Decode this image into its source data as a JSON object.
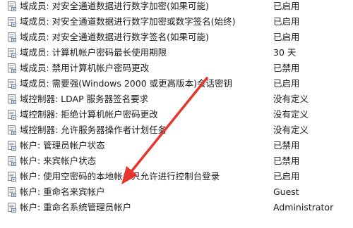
{
  "policies": [
    {
      "name": "域成员: 对安全通道数据进行数字加密(如果可能)",
      "setting": "已启用",
      "icon": "policy-icon"
    },
    {
      "name": "域成员: 对安全通道数据进行数字加密或数字签名(始终)",
      "setting": "已启用",
      "icon": "policy-icon"
    },
    {
      "name": "域成员: 对安全通道数据进行数字签名(如果可能)",
      "setting": "已启用",
      "icon": "policy-icon"
    },
    {
      "name": "域成员: 计算机帐户密码最长使用期限",
      "setting": "30 天",
      "icon": "policy-icon"
    },
    {
      "name": "域成员: 禁用计算机帐户密码更改",
      "setting": "已禁用",
      "icon": "policy-icon"
    },
    {
      "name": "域成员: 需要强(Windows 2000 或更高版本)会话密钥",
      "setting": "已启用",
      "icon": "policy-icon"
    },
    {
      "name": "域控制器: LDAP 服务器签名要求",
      "setting": "没有定义",
      "icon": "policy-icon"
    },
    {
      "name": "域控制器: 拒绝计算机帐户密码更改",
      "setting": "没有定义",
      "icon": "policy-icon"
    },
    {
      "name": "域控制器: 允许服务器操作者计划任务",
      "setting": "没有定义",
      "icon": "policy-icon"
    },
    {
      "name": "帐户: 管理员帐户状态",
      "setting": "已禁用",
      "icon": "policy-icon"
    },
    {
      "name": "帐户: 来宾帐户状态",
      "setting": "已禁用",
      "icon": "policy-icon"
    },
    {
      "name": "帐户: 使用空密码的本地帐户只允许进行控制台登录",
      "setting": "已启用",
      "icon": "policy-icon"
    },
    {
      "name": "帐户: 重命名来宾帐户",
      "setting": "Guest",
      "icon": "policy-icon"
    },
    {
      "name": "帐户: 重命名系统管理员帐户",
      "setting": "Administrator",
      "icon": "policy-icon"
    }
  ],
  "annotation": {
    "color": "#e8342a"
  }
}
